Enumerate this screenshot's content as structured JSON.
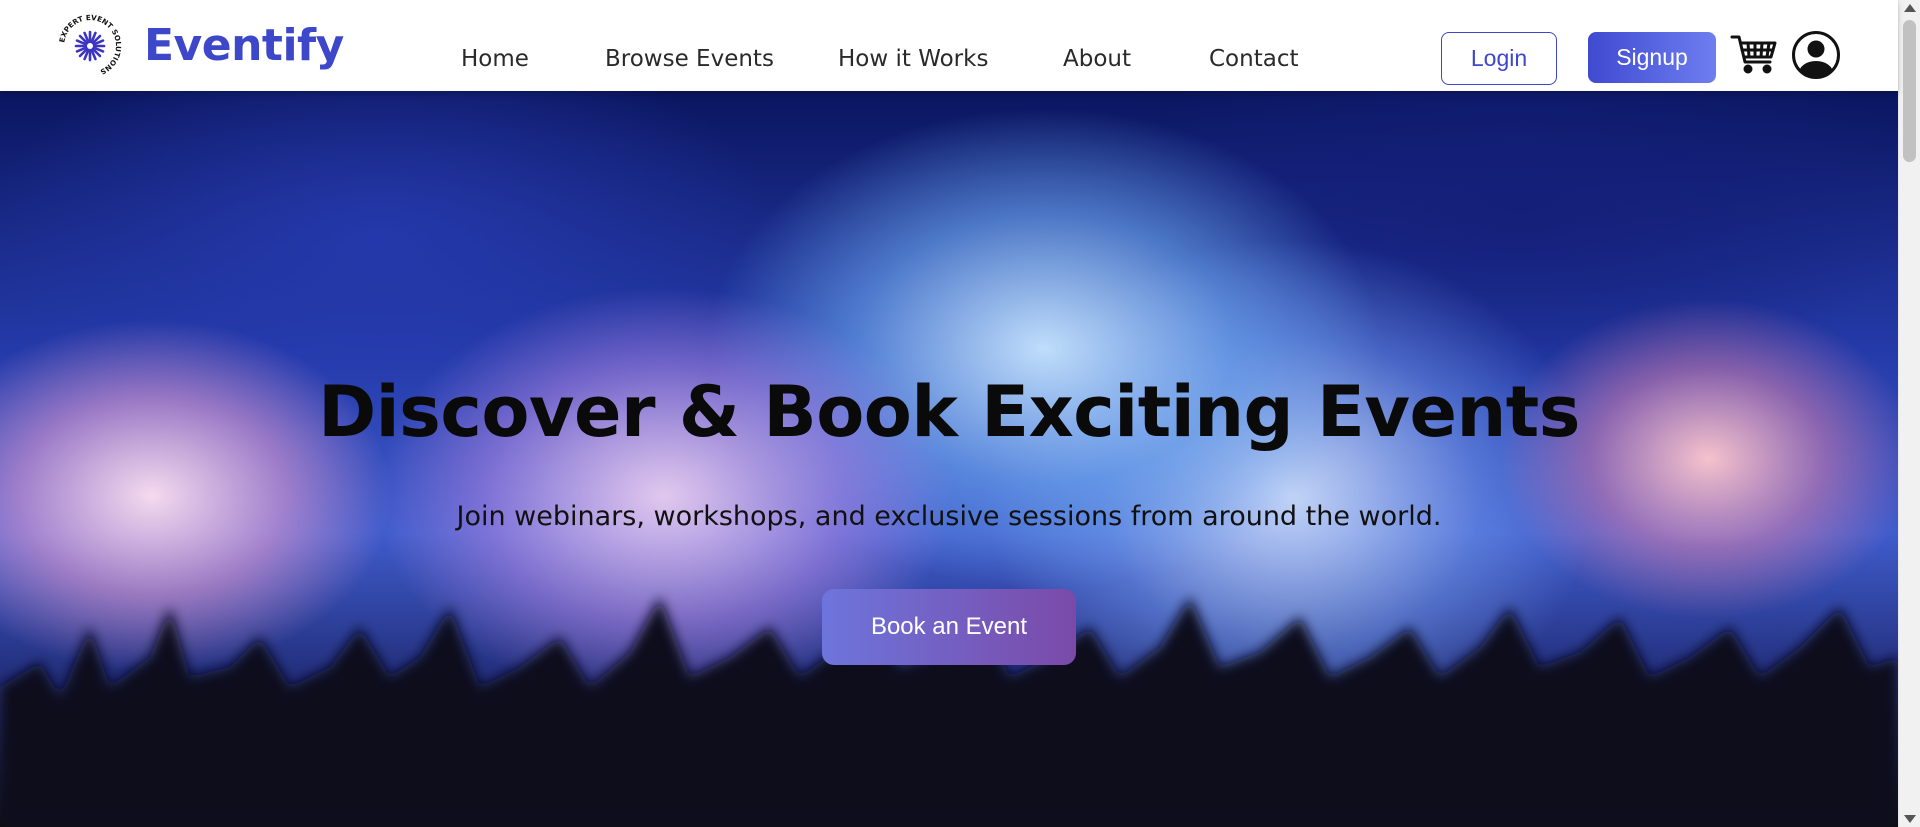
{
  "brand": {
    "name": "Eventify",
    "logo_text": "EXPERT EVENT SOLUTIONS",
    "logo_icon": "starburst-icon",
    "color": "#3d47c9"
  },
  "nav": {
    "items": [
      {
        "label": "Home"
      },
      {
        "label": "Browse Events"
      },
      {
        "label": "How it Works"
      },
      {
        "label": "About"
      },
      {
        "label": "Contact"
      }
    ]
  },
  "actions": {
    "login_label": "Login",
    "signup_label": "Signup",
    "cart_icon": "cart-icon",
    "user_icon": "user-account-icon"
  },
  "hero": {
    "title": "Discover & Book Exciting Events",
    "subtitle": "Join webinars, workshops, and exclusive sessions from around the world.",
    "cta_label": "Book an Event",
    "cta_gradient": [
      "#6d75dc",
      "#7b4aa8"
    ]
  }
}
